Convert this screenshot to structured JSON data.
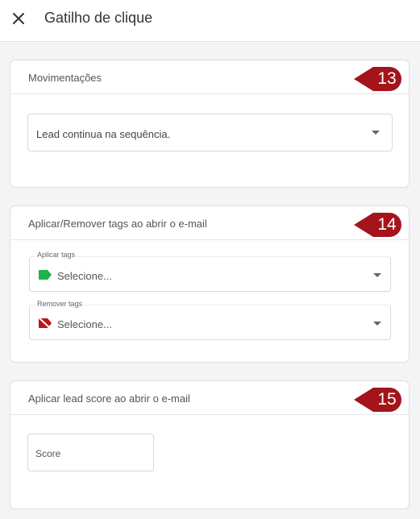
{
  "header": {
    "title": "Gatilho de clique",
    "close_icon": "close-icon"
  },
  "sections": {
    "movimentacoes": {
      "title": "Movimentações",
      "badge": "13",
      "select_value": "Lead continua na sequência."
    },
    "tags": {
      "title": "Aplicar/Remover tags ao abrir o e-mail",
      "badge": "14",
      "apply_label": "Aplicar tags",
      "apply_placeholder": "Selecione...",
      "apply_icon": "tag-icon",
      "remove_label": "Remover tags",
      "remove_placeholder": "Selecione...",
      "remove_icon": "tag-off-icon"
    },
    "score": {
      "title": "Aplicar lead score ao abrir o e-mail",
      "badge": "15",
      "placeholder": "Score"
    }
  },
  "colors": {
    "badge": "#a4141b",
    "apply_tag": "#1fb24a",
    "remove_tag": "#c0121a"
  }
}
